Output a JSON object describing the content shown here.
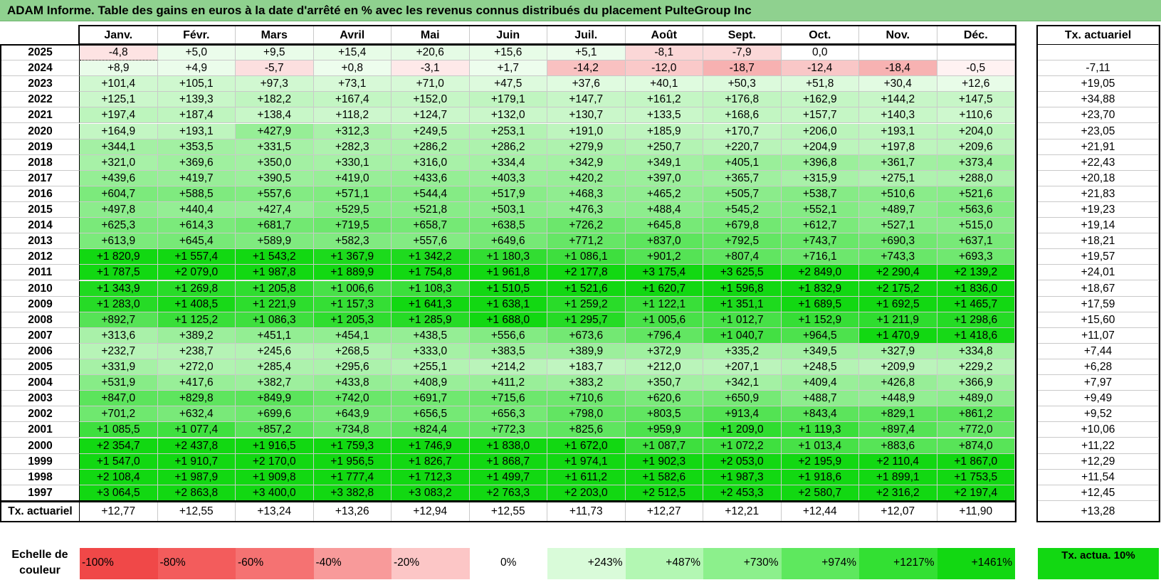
{
  "title": "ADAM Informe. Table des gains en euros à la date d'arrêté en % avec les revenus connus distribués du placement PulteGroup Inc",
  "months": [
    "Janv.",
    "Févr.",
    "Mars",
    "Avril",
    "Mai",
    "Juin",
    "Juil.",
    "Août",
    "Sept.",
    "Oct.",
    "Nov.",
    "Déc."
  ],
  "actuarial_header": "Tx. actuariel",
  "footer_label": "Tx. actuariel",
  "footer_values": [
    "+12,77",
    "+12,55",
    "+13,24",
    "+13,26",
    "+12,94",
    "+12,55",
    "+11,73",
    "+12,27",
    "+12,21",
    "+12,44",
    "+12,07",
    "+11,90"
  ],
  "footer_overall": "+13,28",
  "scale": {
    "label": "Echelle de couleur",
    "steps": [
      "-100%",
      "-80%",
      "-60%",
      "-40%",
      "-20%",
      "0%",
      "+243%",
      "+487%",
      "+730%",
      "+974%",
      "+1217%",
      "+1461%"
    ],
    "colors": [
      "#f04848",
      "#f35c5c",
      "#f57272",
      "#f89a9a",
      "#fcc6c6",
      "#ffffff",
      "#d9fbd9",
      "#b3f7b3",
      "#8cf08c",
      "#5ee85e",
      "#33e033",
      "#12d812"
    ],
    "actuarial": "Tx. actua. 10%",
    "actuarial_color": "#12d812"
  },
  "chart_data": {
    "type": "heatmap",
    "title": "ADAM Informe. Table des gains en euros à la date d'arrêté en % avec les revenus connus distribués du placement PulteGroup Inc",
    "columns": [
      "Janv.",
      "Févr.",
      "Mars",
      "Avril",
      "Mai",
      "Juin",
      "Juil.",
      "Août",
      "Sept.",
      "Oct.",
      "Nov.",
      "Déc."
    ],
    "rows": [
      {
        "year": "2025",
        "values": [
          -4.8,
          5.0,
          9.5,
          15.4,
          20.6,
          15.6,
          5.1,
          -8.1,
          -7.9,
          0.0,
          null,
          null
        ],
        "labels": [
          "-4,8",
          "+5,0",
          "+9,5",
          "+15,4",
          "+20,6",
          "+15,6",
          "+5,1",
          "-8,1",
          "-7,9",
          "0,0",
          "",
          ""
        ],
        "actuarial": ""
      },
      {
        "year": "2024",
        "values": [
          8.9,
          4.9,
          -5.7,
          0.8,
          -3.1,
          1.7,
          -14.2,
          -12.0,
          -18.7,
          -12.4,
          -18.4,
          -0.5
        ],
        "labels": [
          "+8,9",
          "+4,9",
          "-5,7",
          "+0,8",
          "-3,1",
          "+1,7",
          "-14,2",
          "-12,0",
          "-18,7",
          "-12,4",
          "-18,4",
          "-0,5"
        ],
        "actuarial": "-7,11"
      },
      {
        "year": "2023",
        "values": [
          101.4,
          105.1,
          97.3,
          73.1,
          71.0,
          47.5,
          37.6,
          40.1,
          50.3,
          51.8,
          30.4,
          12.6
        ],
        "labels": [
          "+101,4",
          "+105,1",
          "+97,3",
          "+73,1",
          "+71,0",
          "+47,5",
          "+37,6",
          "+40,1",
          "+50,3",
          "+51,8",
          "+30,4",
          "+12,6"
        ],
        "actuarial": "+19,05"
      },
      {
        "year": "2022",
        "values": [
          125.1,
          139.3,
          182.2,
          167.4,
          152.0,
          179.1,
          147.7,
          161.2,
          176.8,
          162.9,
          144.2,
          147.5
        ],
        "labels": [
          "+125,1",
          "+139,3",
          "+182,2",
          "+167,4",
          "+152,0",
          "+179,1",
          "+147,7",
          "+161,2",
          "+176,8",
          "+162,9",
          "+144,2",
          "+147,5"
        ],
        "actuarial": "+34,88"
      },
      {
        "year": "2021",
        "values": [
          197.4,
          187.4,
          138.4,
          118.2,
          124.7,
          132.0,
          130.7,
          133.5,
          168.6,
          157.7,
          140.3,
          110.6
        ],
        "labels": [
          "+197,4",
          "+187,4",
          "+138,4",
          "+118,2",
          "+124,7",
          "+132,0",
          "+130,7",
          "+133,5",
          "+168,6",
          "+157,7",
          "+140,3",
          "+110,6"
        ],
        "actuarial": "+23,70"
      },
      {
        "year": "2020",
        "values": [
          164.9,
          193.1,
          427.9,
          312.3,
          249.5,
          253.1,
          191.0,
          185.9,
          170.7,
          206.0,
          193.1,
          204.0
        ],
        "labels": [
          "+164,9",
          "+193,1",
          "+427,9",
          "+312,3",
          "+249,5",
          "+253,1",
          "+191,0",
          "+185,9",
          "+170,7",
          "+206,0",
          "+193,1",
          "+204,0"
        ],
        "actuarial": "+23,05"
      },
      {
        "year": "2019",
        "values": [
          344.1,
          353.5,
          331.5,
          282.3,
          286.2,
          286.2,
          279.9,
          250.7,
          220.7,
          204.9,
          197.8,
          209.6
        ],
        "labels": [
          "+344,1",
          "+353,5",
          "+331,5",
          "+282,3",
          "+286,2",
          "+286,2",
          "+279,9",
          "+250,7",
          "+220,7",
          "+204,9",
          "+197,8",
          "+209,6"
        ],
        "actuarial": "+21,91"
      },
      {
        "year": "2018",
        "values": [
          321.0,
          369.6,
          350.0,
          330.1,
          316.0,
          334.4,
          342.9,
          349.1,
          405.1,
          396.8,
          361.7,
          373.4
        ],
        "labels": [
          "+321,0",
          "+369,6",
          "+350,0",
          "+330,1",
          "+316,0",
          "+334,4",
          "+342,9",
          "+349,1",
          "+405,1",
          "+396,8",
          "+361,7",
          "+373,4"
        ],
        "actuarial": "+22,43"
      },
      {
        "year": "2017",
        "values": [
          439.6,
          419.7,
          390.5,
          419.0,
          433.6,
          403.3,
          420.2,
          397.0,
          365.7,
          315.9,
          275.1,
          288.0
        ],
        "labels": [
          "+439,6",
          "+419,7",
          "+390,5",
          "+419,0",
          "+433,6",
          "+403,3",
          "+420,2",
          "+397,0",
          "+365,7",
          "+315,9",
          "+275,1",
          "+288,0"
        ],
        "actuarial": "+20,18"
      },
      {
        "year": "2016",
        "values": [
          604.7,
          588.5,
          557.6,
          571.1,
          544.4,
          517.9,
          468.3,
          465.2,
          505.7,
          538.7,
          510.6,
          521.6
        ],
        "labels": [
          "+604,7",
          "+588,5",
          "+557,6",
          "+571,1",
          "+544,4",
          "+517,9",
          "+468,3",
          "+465,2",
          "+505,7",
          "+538,7",
          "+510,6",
          "+521,6"
        ],
        "actuarial": "+21,83"
      },
      {
        "year": "2015",
        "values": [
          497.8,
          440.4,
          427.4,
          529.5,
          521.8,
          503.1,
          476.3,
          488.4,
          545.2,
          552.1,
          489.7,
          563.6
        ],
        "labels": [
          "+497,8",
          "+440,4",
          "+427,4",
          "+529,5",
          "+521,8",
          "+503,1",
          "+476,3",
          "+488,4",
          "+545,2",
          "+552,1",
          "+489,7",
          "+563,6"
        ],
        "actuarial": "+19,23"
      },
      {
        "year": "2014",
        "values": [
          625.3,
          614.3,
          681.7,
          719.5,
          658.7,
          638.5,
          726.2,
          645.8,
          679.8,
          612.7,
          527.1,
          515.0
        ],
        "labels": [
          "+625,3",
          "+614,3",
          "+681,7",
          "+719,5",
          "+658,7",
          "+638,5",
          "+726,2",
          "+645,8",
          "+679,8",
          "+612,7",
          "+527,1",
          "+515,0"
        ],
        "actuarial": "+19,14"
      },
      {
        "year": "2013",
        "values": [
          613.9,
          645.4,
          589.9,
          582.3,
          557.6,
          649.6,
          771.2,
          837.0,
          792.5,
          743.7,
          690.3,
          637.1
        ],
        "labels": [
          "+613,9",
          "+645,4",
          "+589,9",
          "+582,3",
          "+557,6",
          "+649,6",
          "+771,2",
          "+837,0",
          "+792,5",
          "+743,7",
          "+690,3",
          "+637,1"
        ],
        "actuarial": "+18,21"
      },
      {
        "year": "2012",
        "values": [
          1820.9,
          1557.4,
          1543.2,
          1367.9,
          1342.2,
          1180.3,
          1086.1,
          901.2,
          807.4,
          716.1,
          743.3,
          693.3
        ],
        "labels": [
          "+1 820,9",
          "+1 557,4",
          "+1 543,2",
          "+1 367,9",
          "+1 342,2",
          "+1 180,3",
          "+1 086,1",
          "+901,2",
          "+807,4",
          "+716,1",
          "+743,3",
          "+693,3"
        ],
        "actuarial": "+19,57"
      },
      {
        "year": "2011",
        "values": [
          1787.5,
          2079.0,
          1987.8,
          1889.9,
          1754.8,
          1961.8,
          2177.8,
          3175.4,
          3625.5,
          2849.0,
          2290.4,
          2139.2
        ],
        "labels": [
          "+1 787,5",
          "+2 079,0",
          "+1 987,8",
          "+1 889,9",
          "+1 754,8",
          "+1 961,8",
          "+2 177,8",
          "+3 175,4",
          "+3 625,5",
          "+2 849,0",
          "+2 290,4",
          "+2 139,2"
        ],
        "actuarial": "+24,01"
      },
      {
        "year": "2010",
        "values": [
          1343.9,
          1269.8,
          1205.8,
          1006.6,
          1108.3,
          1510.5,
          1521.6,
          1620.7,
          1596.8,
          1832.9,
          2175.2,
          1836.0
        ],
        "labels": [
          "+1 343,9",
          "+1 269,8",
          "+1 205,8",
          "+1 006,6",
          "+1 108,3",
          "+1 510,5",
          "+1 521,6",
          "+1 620,7",
          "+1 596,8",
          "+1 832,9",
          "+2 175,2",
          "+1 836,0"
        ],
        "actuarial": "+18,67"
      },
      {
        "year": "2009",
        "values": [
          1283.0,
          1408.5,
          1221.9,
          1157.3,
          1641.3,
          1638.1,
          1259.2,
          1122.1,
          1351.1,
          1689.5,
          1692.5,
          1465.7
        ],
        "labels": [
          "+1 283,0",
          "+1 408,5",
          "+1 221,9",
          "+1 157,3",
          "+1 641,3",
          "+1 638,1",
          "+1 259,2",
          "+1 122,1",
          "+1 351,1",
          "+1 689,5",
          "+1 692,5",
          "+1 465,7"
        ],
        "actuarial": "+17,59"
      },
      {
        "year": "2008",
        "values": [
          892.7,
          1125.2,
          1086.3,
          1205.3,
          1285.9,
          1688.0,
          1295.7,
          1005.6,
          1012.7,
          1152.9,
          1211.9,
          1298.6
        ],
        "labels": [
          "+892,7",
          "+1 125,2",
          "+1 086,3",
          "+1 205,3",
          "+1 285,9",
          "+1 688,0",
          "+1 295,7",
          "+1 005,6",
          "+1 012,7",
          "+1 152,9",
          "+1 211,9",
          "+1 298,6"
        ],
        "actuarial": "+15,60"
      },
      {
        "year": "2007",
        "values": [
          313.6,
          389.2,
          451.1,
          454.1,
          438.5,
          556.6,
          673.6,
          796.4,
          1040.7,
          964.5,
          1470.9,
          1418.6
        ],
        "labels": [
          "+313,6",
          "+389,2",
          "+451,1",
          "+454,1",
          "+438,5",
          "+556,6",
          "+673,6",
          "+796,4",
          "+1 040,7",
          "+964,5",
          "+1 470,9",
          "+1 418,6"
        ],
        "actuarial": "+11,07"
      },
      {
        "year": "2006",
        "values": [
          232.7,
          238.7,
          245.6,
          268.5,
          333.0,
          383.5,
          389.9,
          372.9,
          335.2,
          349.5,
          327.9,
          334.8
        ],
        "labels": [
          "+232,7",
          "+238,7",
          "+245,6",
          "+268,5",
          "+333,0",
          "+383,5",
          "+389,9",
          "+372,9",
          "+335,2",
          "+349,5",
          "+327,9",
          "+334,8"
        ],
        "actuarial": "+7,44"
      },
      {
        "year": "2005",
        "values": [
          331.9,
          272.0,
          285.4,
          295.6,
          255.1,
          214.2,
          183.7,
          212.0,
          207.1,
          248.5,
          209.9,
          229.2
        ],
        "labels": [
          "+331,9",
          "+272,0",
          "+285,4",
          "+295,6",
          "+255,1",
          "+214,2",
          "+183,7",
          "+212,0",
          "+207,1",
          "+248,5",
          "+209,9",
          "+229,2"
        ],
        "actuarial": "+6,28"
      },
      {
        "year": "2004",
        "values": [
          531.9,
          417.6,
          382.7,
          433.8,
          408.9,
          411.2,
          383.2,
          350.7,
          342.1,
          409.4,
          426.8,
          366.9
        ],
        "labels": [
          "+531,9",
          "+417,6",
          "+382,7",
          "+433,8",
          "+408,9",
          "+411,2",
          "+383,2",
          "+350,7",
          "+342,1",
          "+409,4",
          "+426,8",
          "+366,9"
        ],
        "actuarial": "+7,97"
      },
      {
        "year": "2003",
        "values": [
          847.0,
          829.8,
          849.9,
          742.0,
          691.7,
          715.6,
          710.6,
          620.6,
          650.9,
          488.7,
          448.9,
          489.0
        ],
        "labels": [
          "+847,0",
          "+829,8",
          "+849,9",
          "+742,0",
          "+691,7",
          "+715,6",
          "+710,6",
          "+620,6",
          "+650,9",
          "+488,7",
          "+448,9",
          "+489,0"
        ],
        "actuarial": "+9,49"
      },
      {
        "year": "2002",
        "values": [
          701.2,
          632.4,
          699.6,
          643.9,
          656.5,
          656.3,
          798.0,
          803.5,
          913.4,
          843.4,
          829.1,
          861.2
        ],
        "labels": [
          "+701,2",
          "+632,4",
          "+699,6",
          "+643,9",
          "+656,5",
          "+656,3",
          "+798,0",
          "+803,5",
          "+913,4",
          "+843,4",
          "+829,1",
          "+861,2"
        ],
        "actuarial": "+9,52"
      },
      {
        "year": "2001",
        "values": [
          1085.5,
          1077.4,
          857.2,
          734.8,
          824.4,
          772.3,
          825.6,
          959.9,
          1209.0,
          1119.3,
          897.4,
          772.0
        ],
        "labels": [
          "+1 085,5",
          "+1 077,4",
          "+857,2",
          "+734,8",
          "+824,4",
          "+772,3",
          "+825,6",
          "+959,9",
          "+1 209,0",
          "+1 119,3",
          "+897,4",
          "+772,0"
        ],
        "actuarial": "+10,06"
      },
      {
        "year": "2000",
        "values": [
          2354.7,
          2437.8,
          1916.5,
          1759.3,
          1746.9,
          1838.0,
          1672.0,
          1087.7,
          1072.2,
          1013.4,
          883.6,
          874.0
        ],
        "labels": [
          "+2 354,7",
          "+2 437,8",
          "+1 916,5",
          "+1 759,3",
          "+1 746,9",
          "+1 838,0",
          "+1 672,0",
          "+1 087,7",
          "+1 072,2",
          "+1 013,4",
          "+883,6",
          "+874,0"
        ],
        "actuarial": "+11,22"
      },
      {
        "year": "1999",
        "values": [
          1547.0,
          1910.7,
          2170.0,
          1956.5,
          1826.7,
          1868.7,
          1974.1,
          1902.3,
          2053.0,
          2195.9,
          2110.4,
          1867.0
        ],
        "labels": [
          "+1 547,0",
          "+1 910,7",
          "+2 170,0",
          "+1 956,5",
          "+1 826,7",
          "+1 868,7",
          "+1 974,1",
          "+1 902,3",
          "+2 053,0",
          "+2 195,9",
          "+2 110,4",
          "+1 867,0"
        ],
        "actuarial": "+12,29"
      },
      {
        "year": "1998",
        "values": [
          2108.4,
          1987.9,
          1909.8,
          1777.4,
          1712.3,
          1499.7,
          1611.2,
          1582.6,
          1987.3,
          1918.6,
          1899.1,
          1753.5
        ],
        "labels": [
          "+2 108,4",
          "+1 987,9",
          "+1 909,8",
          "+1 777,4",
          "+1 712,3",
          "+1 499,7",
          "+1 611,2",
          "+1 582,6",
          "+1 987,3",
          "+1 918,6",
          "+1 899,1",
          "+1 753,5"
        ],
        "actuarial": "+11,54"
      },
      {
        "year": "1997",
        "values": [
          3064.5,
          2863.8,
          3400.0,
          3382.8,
          3083.2,
          2763.3,
          2203.0,
          2512.5,
          2453.3,
          2580.7,
          2316.2,
          2197.4
        ],
        "labels": [
          "+3 064,5",
          "+2 863,8",
          "+3 400,0",
          "+3 382,8",
          "+3 083,2",
          "+2 763,3",
          "+2 203,0",
          "+2 512,5",
          "+2 453,3",
          "+2 580,7",
          "+2 316,2",
          "+2 197,4"
        ],
        "actuarial": "+12,45"
      }
    ]
  }
}
